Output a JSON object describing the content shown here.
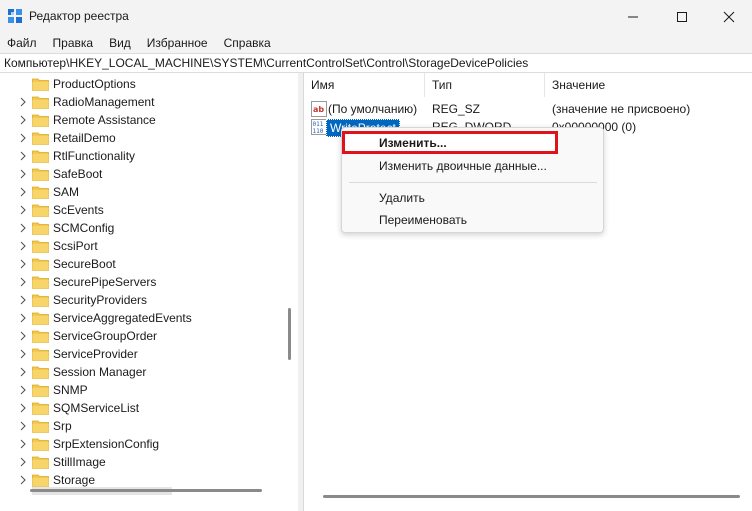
{
  "window": {
    "title": "Редактор реестра",
    "icon": "registry-editor-icon",
    "controls": [
      "minimize-icon",
      "maximize-icon",
      "close-icon"
    ]
  },
  "menu": [
    "Файл",
    "Правка",
    "Вид",
    "Избранное",
    "Справка"
  ],
  "address": "Компьютер\\HKEY_LOCAL_MACHINE\\SYSTEM\\CurrentControlSet\\Control\\StorageDevicePolicies",
  "tree": {
    "items": [
      {
        "label": "ProductOptions",
        "expandable": false
      },
      {
        "label": "RadioManagement",
        "expandable": true
      },
      {
        "label": "Remote Assistance",
        "expandable": true
      },
      {
        "label": "RetailDemo",
        "expandable": true
      },
      {
        "label": "RtlFunctionality",
        "expandable": true
      },
      {
        "label": "SafeBoot",
        "expandable": true
      },
      {
        "label": "SAM",
        "expandable": true
      },
      {
        "label": "ScEvents",
        "expandable": true
      },
      {
        "label": "SCMConfig",
        "expandable": true
      },
      {
        "label": "ScsiPort",
        "expandable": true
      },
      {
        "label": "SecureBoot",
        "expandable": true
      },
      {
        "label": "SecurePipeServers",
        "expandable": true
      },
      {
        "label": "SecurityProviders",
        "expandable": true
      },
      {
        "label": "ServiceAggregatedEvents",
        "expandable": true
      },
      {
        "label": "ServiceGroupOrder",
        "expandable": true
      },
      {
        "label": "ServiceProvider",
        "expandable": true
      },
      {
        "label": "Session Manager",
        "expandable": true
      },
      {
        "label": "SNMP",
        "expandable": true
      },
      {
        "label": "SQMServiceList",
        "expandable": true
      },
      {
        "label": "Srp",
        "expandable": true
      },
      {
        "label": "SrpExtensionConfig",
        "expandable": true
      },
      {
        "label": "StillImage",
        "expandable": true
      },
      {
        "label": "Storage",
        "expandable": true
      }
    ]
  },
  "list": {
    "columns": [
      "Имя",
      "Тип",
      "Значение"
    ],
    "rows": [
      {
        "icon": "string-value-icon",
        "name": "(По умолчанию)",
        "type": "REG_SZ",
        "data": "(значение не присвоено)"
      },
      {
        "icon": "dword-value-icon",
        "name": "WriteProtect",
        "type": "REG_DWORD",
        "data": "0x00000000 (0)",
        "selected": true
      }
    ]
  },
  "context_menu": {
    "items": [
      "Изменить...",
      "Изменить двоичные данные...",
      "Удалить",
      "Переименовать"
    ],
    "highlight_color": "#e0121b"
  },
  "colors": {
    "selection": "#0067c0",
    "folder": "#f2c94c",
    "chrome": "#f3f3f3"
  }
}
